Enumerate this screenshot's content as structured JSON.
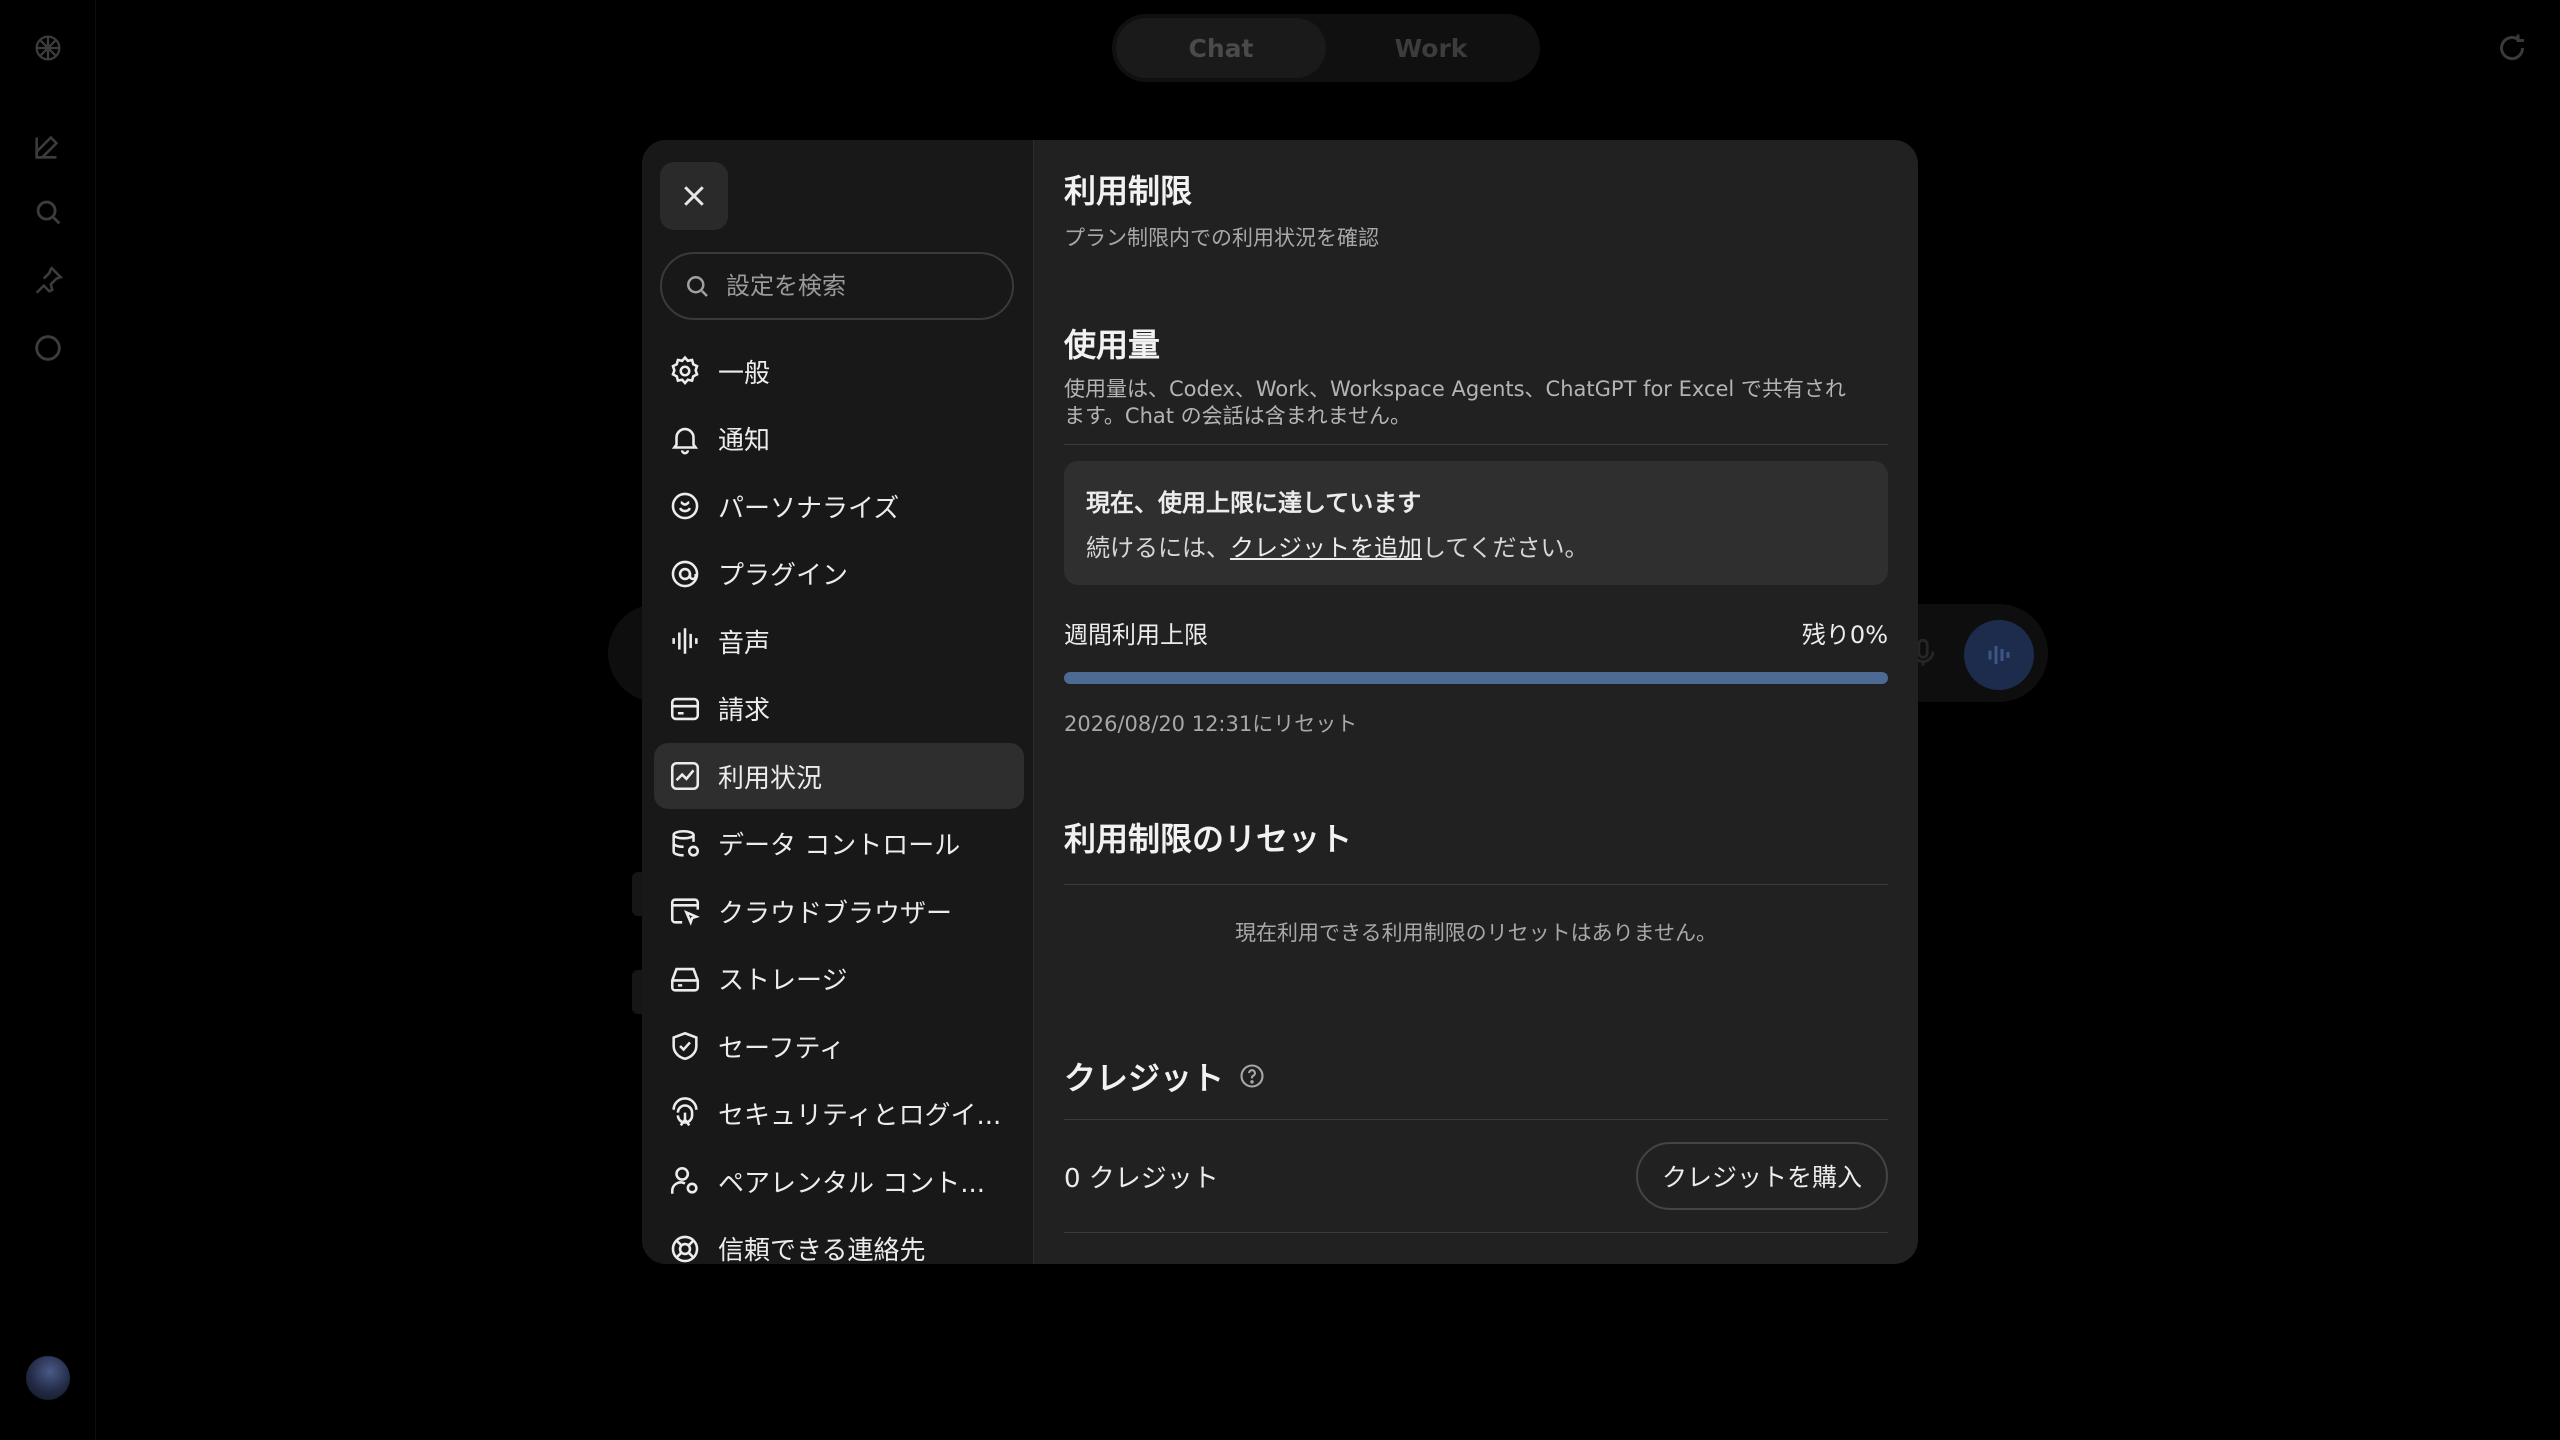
{
  "top_toggle": {
    "tabs": [
      "Chat",
      "Work"
    ],
    "active": "Chat"
  },
  "rail": {
    "icons": [
      "logo-icon",
      "new-chat-icon",
      "search-icon",
      "pin-icon",
      "chat-bubble-icon"
    ]
  },
  "settings": {
    "search_placeholder": "設定を検索",
    "nav": [
      {
        "label": "一般",
        "icon": "gear-icon"
      },
      {
        "label": "通知",
        "icon": "bell-icon"
      },
      {
        "label": "パーソナライズ",
        "icon": "personalize-icon"
      },
      {
        "label": "プラグイン",
        "icon": "plugin-icon"
      },
      {
        "label": "音声",
        "icon": "waveform-icon"
      },
      {
        "label": "請求",
        "icon": "card-icon"
      },
      {
        "label": "利用状況",
        "icon": "usage-chart-icon",
        "active": true
      },
      {
        "label": "データ コントロール",
        "icon": "database-icon"
      },
      {
        "label": "クラウドブラウザー",
        "icon": "cloud-browser-icon"
      },
      {
        "label": "ストレージ",
        "icon": "storage-icon"
      },
      {
        "label": "セーフティ",
        "icon": "shield-icon"
      },
      {
        "label": "セキュリティとログイ...",
        "icon": "security-icon"
      },
      {
        "label": "ペアレンタル コント...",
        "icon": "parental-icon"
      },
      {
        "label": "信頼できる連絡先",
        "icon": "lifebuoy-icon"
      }
    ]
  },
  "usage": {
    "title": "利用制限",
    "subtitle": "プラン制限内での利用状況を確認",
    "usage_title": "使用量",
    "usage_desc_line1": "使用量は、Codex、Work、Workspace Agents、ChatGPT for Excel で共有され",
    "usage_desc_line2": "ます。Chat の会話は含まれません。",
    "alert_title": "現在、使用上限に達しています",
    "alert_prefix": "続けるには、",
    "alert_link": "クレジットを追加",
    "alert_suffix": "してください。",
    "weekly_label": "週間利用上限",
    "weekly_remaining": "残り0%",
    "weekly_used_fraction": 1.0,
    "reset_at": "2026/08/20 12:31にリセット",
    "reset_section_title": "利用制限のリセット",
    "reset_empty": "現在利用できる利用制限のリセットはありません。",
    "credits_title": "クレジット",
    "credits_count": "0 クレジット",
    "buy_button": "クレジットを購入"
  },
  "colors": {
    "progress_fill": "#4c6a94",
    "modal_bg": "#212121",
    "sidebar_bg": "#181818"
  }
}
